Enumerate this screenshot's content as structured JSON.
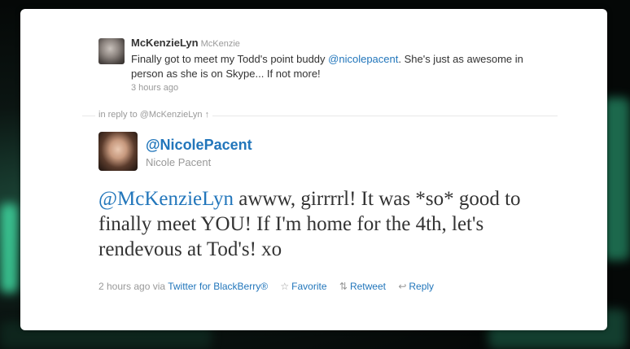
{
  "original_tweet": {
    "username": "McKenzieLyn",
    "fullname": "McKenzie",
    "text_before": "Finally got to meet my Todd's point buddy ",
    "mention": "@nicolepacent",
    "text_after": ". She's just as awesome in person as she is on Skype... If not more!",
    "timestamp": "3 hours ago"
  },
  "reply_context": {
    "label": "in reply to @McKenzieLyn ↑"
  },
  "author": {
    "handle": "@NicolePacent",
    "name": "Nicole Pacent"
  },
  "tweet": {
    "mention": "@McKenzieLyn",
    "text": " awww, girrrrl! It was *so* good to finally meet YOU! If I'm home for the 4th, let's rendevous at Tod's! xo"
  },
  "meta": {
    "time": "2 hours ago",
    "via_label": " via ",
    "source": "Twitter for BlackBerry®",
    "favorite_icon": "☆",
    "favorite": "Favorite",
    "retweet_icon": "⇅",
    "retweet": "Retweet",
    "reply_icon": "↩",
    "reply": "Reply"
  },
  "colors": {
    "link": "#2276bb",
    "muted": "#999999",
    "text": "#333333"
  }
}
